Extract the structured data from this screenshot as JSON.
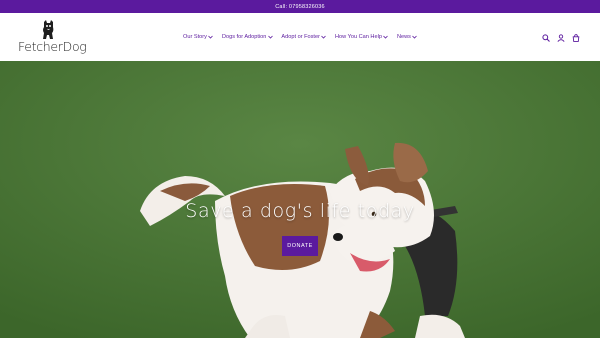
{
  "announcement": {
    "text": "Call: 07958326036"
  },
  "brand": {
    "logo_text": "FetcherDog"
  },
  "nav": {
    "items": [
      {
        "label": "Our Story"
      },
      {
        "label": "Dogs for Adoption"
      },
      {
        "label": "Adopt or Foster"
      },
      {
        "label": "How You Can Help"
      },
      {
        "label": "News"
      }
    ]
  },
  "header_icons": [
    "search-icon",
    "account-icon",
    "cart-icon"
  ],
  "hero": {
    "title": "Save a dog's life today",
    "button_label": "DONATE"
  },
  "colors": {
    "brand_purple": "#5b1a9e",
    "grass_green": "#4b7534",
    "text_dark": "#1e1e1e"
  }
}
